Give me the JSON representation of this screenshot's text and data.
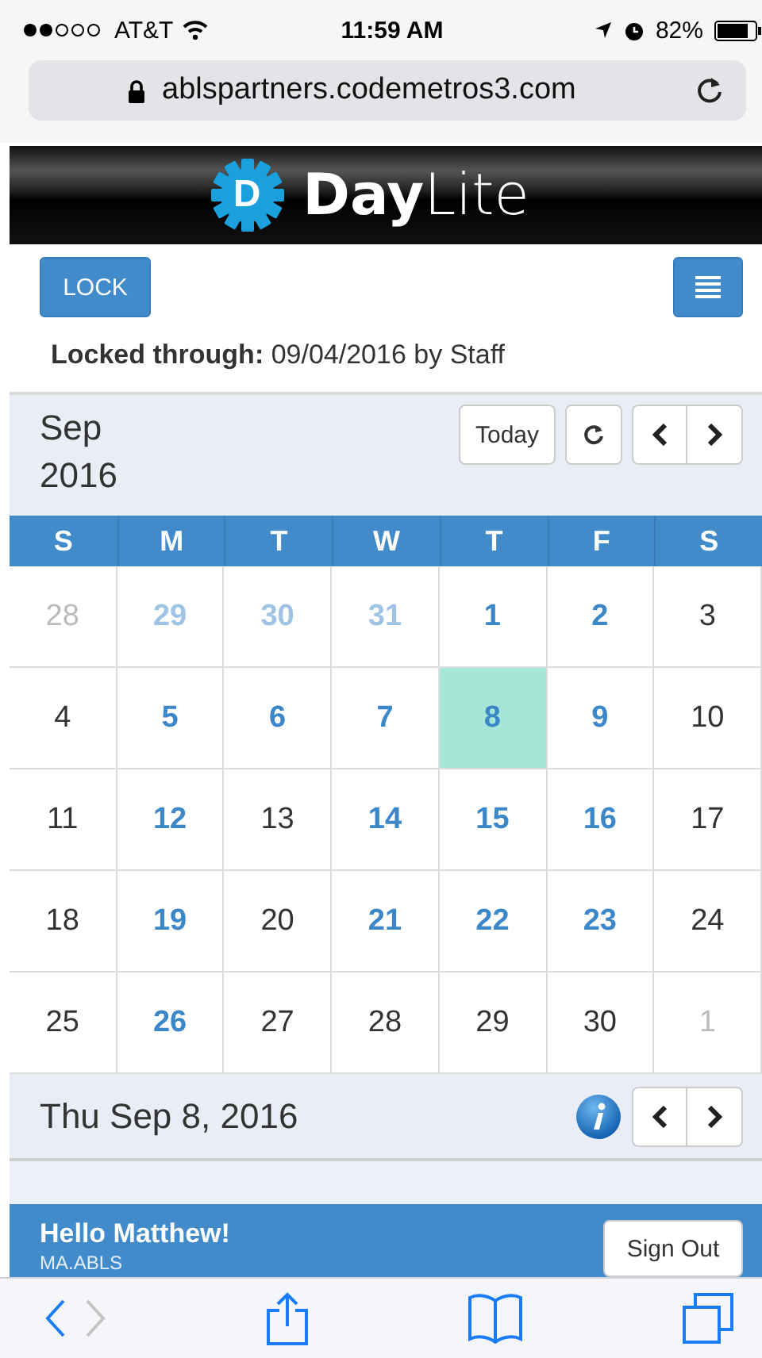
{
  "status_bar": {
    "carrier": "AT&T",
    "time": "11:59 AM",
    "battery": "82%"
  },
  "address_bar": {
    "url": "ablspartners.codemetros3.com"
  },
  "banner": {
    "badge": "D",
    "title": "**Day**Lite"
  },
  "controls": {
    "lock_button": "LOCK"
  },
  "lock_info": "**Locked through:** 09/04/2016 by Staff",
  "calendar": {
    "month": "Sep",
    "year": "2016",
    "today_button": "Today",
    "weekdays": [
      "S",
      "M",
      "T",
      "W",
      "T",
      "F",
      "S"
    ],
    "weeks": [
      [
        {
          "label": "28",
          "kind": "other",
          "selected": false
        },
        {
          "label": "29",
          "kind": "faded",
          "selected": false
        },
        {
          "label": "30",
          "kind": "faded",
          "selected": false
        },
        {
          "label": "31",
          "kind": "faded",
          "selected": false
        },
        {
          "label": "1",
          "kind": "event",
          "selected": false
        },
        {
          "label": "2",
          "kind": "event",
          "selected": false
        },
        {
          "label": "3",
          "kind": "plain",
          "selected": false
        }
      ],
      [
        {
          "label": "4",
          "kind": "plain",
          "selected": false
        },
        {
          "label": "5",
          "kind": "event",
          "selected": false
        },
        {
          "label": "6",
          "kind": "event",
          "selected": false
        },
        {
          "label": "7",
          "kind": "event",
          "selected": false
        },
        {
          "label": "8",
          "kind": "event",
          "selected": true
        },
        {
          "label": "9",
          "kind": "event",
          "selected": false
        },
        {
          "label": "10",
          "kind": "plain",
          "selected": false
        }
      ],
      [
        {
          "label": "11",
          "kind": "plain",
          "selected": false
        },
        {
          "label": "12",
          "kind": "event",
          "selected": false
        },
        {
          "label": "13",
          "kind": "plain",
          "selected": false
        },
        {
          "label": "14",
          "kind": "event",
          "selected": false
        },
        {
          "label": "15",
          "kind": "event",
          "selected": false
        },
        {
          "label": "16",
          "kind": "event",
          "selected": false
        },
        {
          "label": "17",
          "kind": "plain",
          "selected": false
        }
      ],
      [
        {
          "label": "18",
          "kind": "plain",
          "selected": false
        },
        {
          "label": "19",
          "kind": "event",
          "selected": false
        },
        {
          "label": "20",
          "kind": "plain",
          "selected": false
        },
        {
          "label": "21",
          "kind": "event",
          "selected": false
        },
        {
          "label": "22",
          "kind": "event",
          "selected": false
        },
        {
          "label": "23",
          "kind": "event",
          "selected": false
        },
        {
          "label": "24",
          "kind": "plain",
          "selected": false
        }
      ],
      [
        {
          "label": "25",
          "kind": "plain",
          "selected": false
        },
        {
          "label": "26",
          "kind": "event",
          "selected": false
        },
        {
          "label": "27",
          "kind": "plain",
          "selected": false
        },
        {
          "label": "28",
          "kind": "plain",
          "selected": false
        },
        {
          "label": "29",
          "kind": "plain",
          "selected": false
        },
        {
          "label": "30",
          "kind": "plain",
          "selected": false
        },
        {
          "label": "1",
          "kind": "other",
          "selected": false
        }
      ]
    ],
    "selected_date": "Thu Sep 8, 2016"
  },
  "footer": {
    "greeting": "Hello Matthew!",
    "username": "MA.ABLS",
    "sign_out_button": "Sign Out"
  },
  "toolbar": {
    "forward_disabled": true
  }
}
